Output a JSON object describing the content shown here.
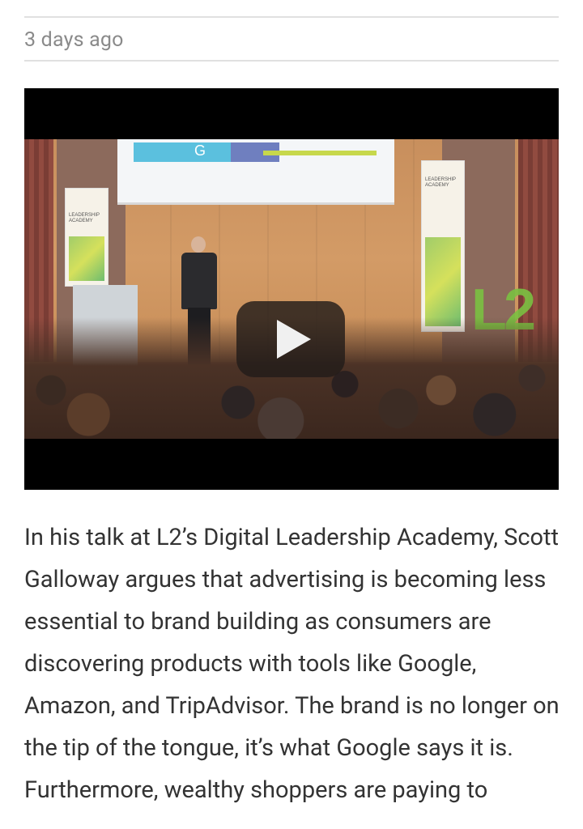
{
  "timestamp": "3 days ago",
  "video": {
    "title_overlay": "",
    "banner_text": "LEADERSHIP ACADEMY",
    "logo_text": "L2",
    "screen_letter": "G",
    "play_button_label": "Play video"
  },
  "article": {
    "paragraph": "In his talk at L2’s Digital Leadership Academy, Scott Galloway argues that advertising is becoming less essential to brand building as consumers are discovering products with tools like Google, Amazon, and TripAdvisor. The brand is no longer on the tip of the tongue, it’s what Google says it is. Furthermore, wealthy shoppers are paying to"
  },
  "colors": {
    "rule": "#e0e0e0",
    "timestamp": "#8a8a8a",
    "body_text": "#333333",
    "video_bg": "#000000"
  }
}
